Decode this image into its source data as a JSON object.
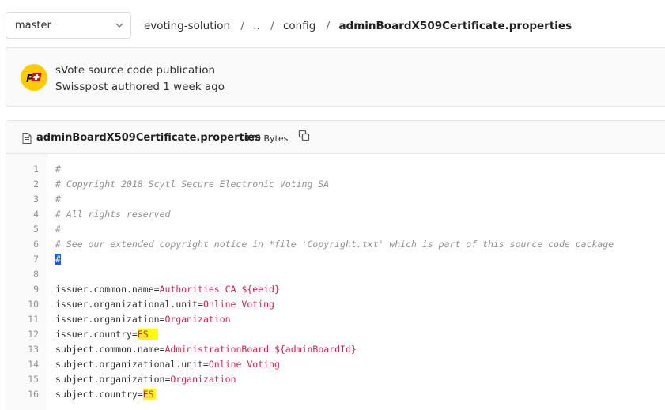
{
  "branch": {
    "label": "master"
  },
  "breadcrumb": {
    "items": [
      "evoting-solution",
      "..",
      "config"
    ],
    "current": "adminBoardX509Certificate.properties"
  },
  "commit": {
    "title": "sVote source code publication",
    "meta": "Swisspost authored 1 week ago"
  },
  "file": {
    "name": "adminBoardX509Certificate.properties",
    "size": "470 Bytes"
  },
  "code": {
    "lines": [
      {
        "n": "1",
        "c": "#"
      },
      {
        "n": "2",
        "c": "# Copyright 2018 Scytl Secure Electronic Voting SA"
      },
      {
        "n": "3",
        "c": "#"
      },
      {
        "n": "4",
        "c": "# All rights reserved"
      },
      {
        "n": "5",
        "c": "#"
      },
      {
        "n": "6",
        "c": "# See our extended copyright notice in *file 'Copyright.txt' which is part of this source code package"
      },
      {
        "n": "7",
        "c": "#"
      },
      {
        "n": "8",
        "c": ""
      },
      {
        "n": "9",
        "k": "issuer.common.name=",
        "v": "Authorities CA ${eeid}"
      },
      {
        "n": "10",
        "k": "issuer.organizational.unit=",
        "v": "Online Voting"
      },
      {
        "n": "11",
        "k": "issuer.organization=",
        "v": "Organization"
      },
      {
        "n": "12",
        "k": "issuer.country=",
        "v": "ES"
      },
      {
        "n": "13",
        "k": "subject.common.name=",
        "v": "AdministrationBoard ${adminBoardId}"
      },
      {
        "n": "14",
        "k": "subject.organizational.unit=",
        "v": "Online Voting"
      },
      {
        "n": "15",
        "k": "subject.organization=",
        "v": "Organization"
      },
      {
        "n": "16",
        "k": "subject.country=",
        "v": "ES"
      }
    ]
  },
  "colors": {
    "value": "#c7254e",
    "comment": "#8f8f8f",
    "highlight": "#ffff00",
    "selection": "#1a5fd0"
  }
}
